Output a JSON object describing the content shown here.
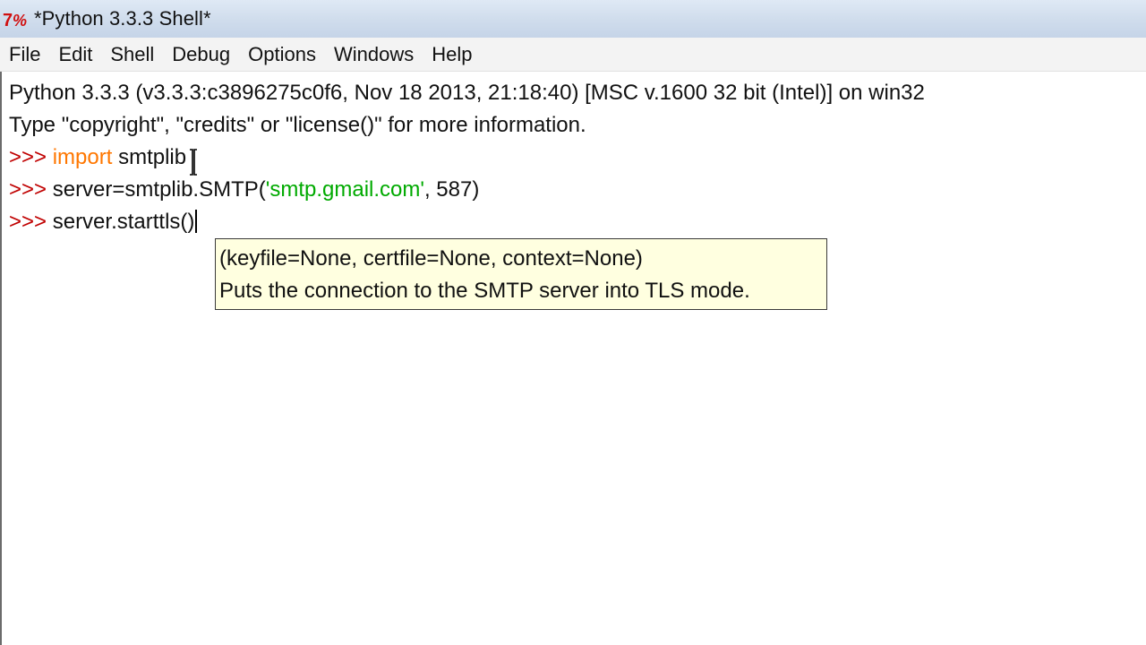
{
  "window": {
    "title": "*Python 3.3.3 Shell*",
    "icon": "idle-python-icon"
  },
  "menu": {
    "items": [
      "File",
      "Edit",
      "Shell",
      "Debug",
      "Options",
      "Windows",
      "Help"
    ]
  },
  "shell": {
    "banner_line1": "Python 3.3.3 (v3.3.3:c3896275c0f6, Nov 18 2013, 21:18:40) [MSC v.1600 32 bit (Intel)] on win32",
    "banner_line2": "Type \"copyright\", \"credits\" or \"license()\" for more information.",
    "prompt": ">>> ",
    "cmd1": {
      "keyword": "import",
      "rest": " smtplib"
    },
    "cmd2": {
      "before": "server=smtplib.SMTP(",
      "string": "'smtp.gmail.com'",
      "after": ", 587)"
    },
    "cmd3": {
      "text": "server.starttls(",
      "closing": ")"
    }
  },
  "calltip": {
    "signature": "(keyfile=None, certfile=None, context=None)",
    "doc": "Puts the connection to the SMTP server into TLS mode."
  },
  "colors": {
    "prompt": "#c00000",
    "keyword": "#ff7700",
    "string": "#00aa00",
    "calltip_bg": "#ffffe0"
  }
}
